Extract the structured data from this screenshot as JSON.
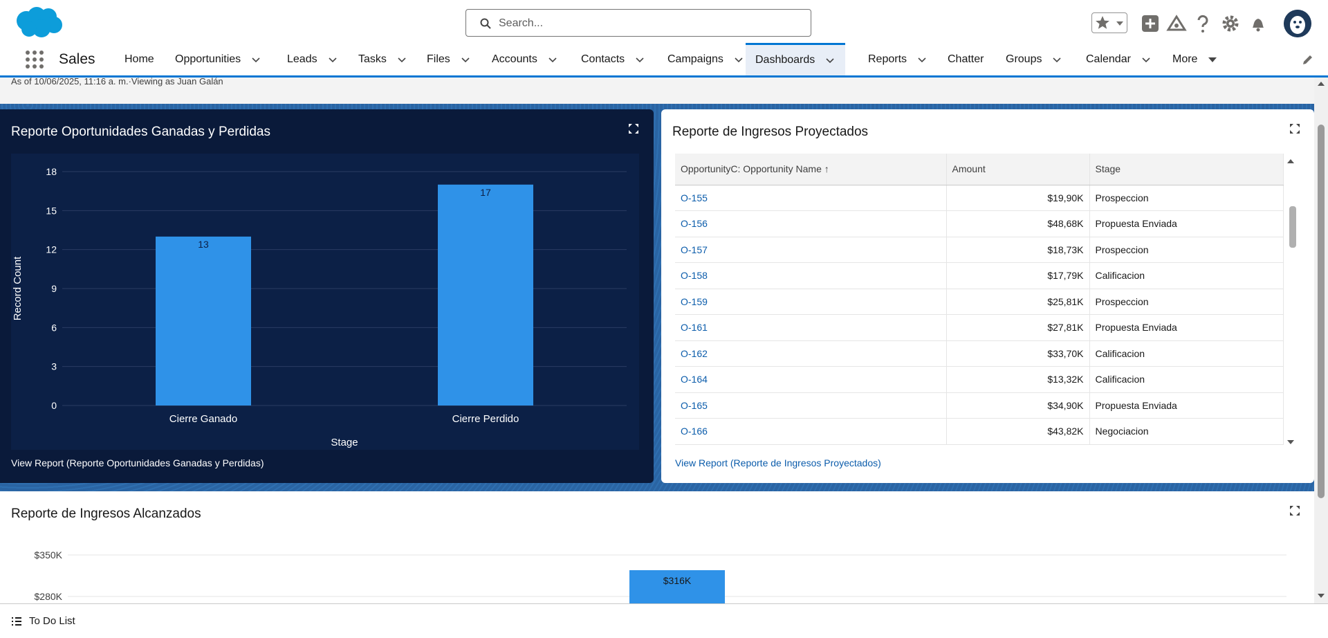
{
  "header": {
    "search_placeholder": "Search...",
    "icons": [
      "favorites-star-icon",
      "chevron-down-icon",
      "add-icon",
      "trailhead-icon",
      "help-icon",
      "setup-gear-icon",
      "notifications-bell-icon",
      "avatar"
    ]
  },
  "nav": {
    "app_name": "Sales",
    "items": [
      {
        "label": "Home",
        "chevron": false
      },
      {
        "label": "Opportunities",
        "chevron": true
      },
      {
        "label": "Leads",
        "chevron": true
      },
      {
        "label": "Tasks",
        "chevron": true
      },
      {
        "label": "Files",
        "chevron": true
      },
      {
        "label": "Accounts",
        "chevron": true
      },
      {
        "label": "Contacts",
        "chevron": true
      },
      {
        "label": "Campaigns",
        "chevron": true
      },
      {
        "label": "Dashboards",
        "chevron": true,
        "active": true
      },
      {
        "label": "Reports",
        "chevron": true
      },
      {
        "label": "Chatter",
        "chevron": false
      },
      {
        "label": "Groups",
        "chevron": true
      },
      {
        "label": "Calendar",
        "chevron": true
      },
      {
        "label": "More",
        "chevron": true
      }
    ]
  },
  "subinfo": "As of 10/06/2025, 11:16 a. m.·Viewing as Juan Galán",
  "chart_panel": {
    "title": "Reporte Oportunidades Ganadas y Perdidas",
    "view_report": "View Report (Reporte Oportunidades Ganadas y Perdidas)"
  },
  "chart_data": {
    "type": "bar",
    "categories": [
      "Cierre Ganado",
      "Cierre Perdido"
    ],
    "values": [
      13,
      17
    ],
    "xlabel": "Stage",
    "ylabel": "Record Count",
    "yticks": [
      "0",
      "3",
      "6",
      "9",
      "12",
      "15",
      "18"
    ],
    "ylim": [
      0,
      18
    ],
    "grid": true,
    "colors": {
      "bar": "#2f92e8",
      "background": "#0c2046",
      "grid": "#2a3b63"
    }
  },
  "table_panel": {
    "title": "Reporte de Ingresos Proyectados",
    "columns": [
      "OpportunityC: Opportunity Name",
      "Amount",
      "Stage"
    ],
    "rows": [
      {
        "name": "O-155",
        "amount": "$19,90K",
        "stage": "Prospeccion"
      },
      {
        "name": "O-156",
        "amount": "$48,68K",
        "stage": "Propuesta Enviada"
      },
      {
        "name": "O-157",
        "amount": "$18,73K",
        "stage": "Prospeccion"
      },
      {
        "name": "O-158",
        "amount": "$17,79K",
        "stage": "Calificacion"
      },
      {
        "name": "O-159",
        "amount": "$25,81K",
        "stage": "Prospeccion"
      },
      {
        "name": "O-161",
        "amount": "$27,81K",
        "stage": "Propuesta Enviada"
      },
      {
        "name": "O-162",
        "amount": "$33,70K",
        "stage": "Calificacion"
      },
      {
        "name": "O-164",
        "amount": "$13,32K",
        "stage": "Calificacion"
      },
      {
        "name": "O-165",
        "amount": "$34,90K",
        "stage": "Propuesta Enviada"
      },
      {
        "name": "O-166",
        "amount": "$43,82K",
        "stage": "Negociacion"
      }
    ],
    "view_report": "View Report (Reporte de Ingresos Proyectados)"
  },
  "bottom_panel": {
    "title": "Reporte de Ingresos Alcanzados",
    "yticks": [
      "$350K",
      "$280K"
    ],
    "bar_label": "$316K"
  },
  "footer": {
    "todo_label": "To Do List"
  }
}
